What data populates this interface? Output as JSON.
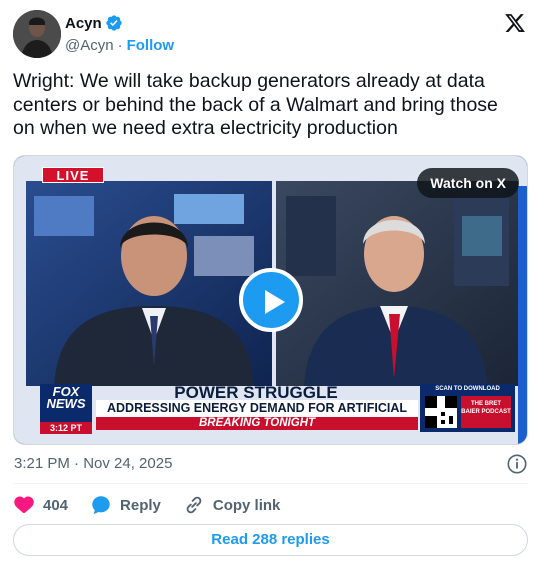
{
  "author": {
    "name": "Acyn",
    "handle": "@Acyn",
    "separator": "·",
    "follow_label": "Follow",
    "verified_color": "#1d9bf0"
  },
  "brand_icon": "x-logo-icon",
  "tweet": {
    "text": "Wright: We will take backup generators already at data centers or behind the back of a Walmart and bring those on when we need extra electricity production"
  },
  "video": {
    "live_label": "LIVE",
    "watch_label": "Watch on X",
    "chyron": {
      "network": "FOX NEWS",
      "network_line1": "FOX",
      "network_line2": "NEWS",
      "time": "3:12 PT",
      "headline": "POWER STRUGGLE",
      "subheadline": "ADDRESSING ENERGY DEMAND FOR ARTIFICIAL INTELLIGENCE",
      "banner": "BREAKING TONIGHT",
      "qr_label": "SCAN TO DOWNLOAD",
      "podcast_label": "THE BRET BAIER PODCAST"
    }
  },
  "timestamp": "3:21 PM · Nov 24, 2025",
  "actions": {
    "likes": "404",
    "reply_label": "Reply",
    "copy_label": "Copy link"
  },
  "read_replies_label": "Read 288 replies",
  "colors": {
    "accent": "#1d9bf0",
    "like": "#f91880",
    "text": "#0f1419",
    "muted": "#536471",
    "fox_blue": "#0b2a6b",
    "fox_red": "#c8102e"
  }
}
